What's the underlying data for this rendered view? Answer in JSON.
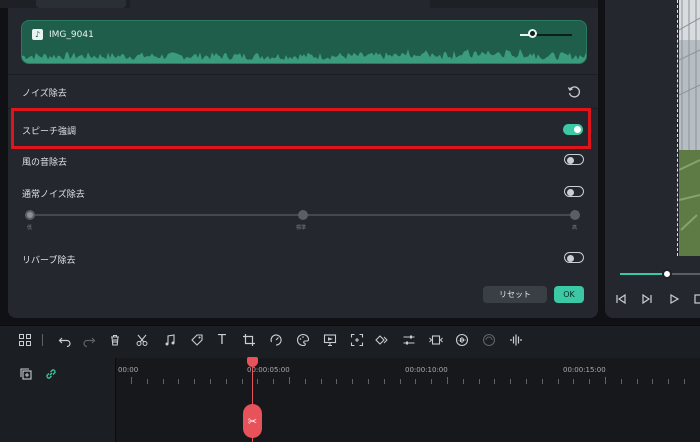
{
  "audio_clip": {
    "name": "IMG_9041"
  },
  "noise_section": {
    "title": "ノイズ除去"
  },
  "settings": [
    {
      "label": "スピーチ強調",
      "on": true
    },
    {
      "label": "風の音除去",
      "on": false
    },
    {
      "label": "通常ノイズ除去",
      "on": false
    },
    {
      "label": "リバーブ除去",
      "on": false
    }
  ],
  "noise_level": {
    "marks": [
      "低",
      "標準",
      "高"
    ],
    "value": 0.0
  },
  "buttons": {
    "reset": "リセット",
    "ok": "OK"
  },
  "player": {
    "progress": 0.6
  },
  "timeline": {
    "times": [
      "00:00",
      "00:00:05:00",
      "00:00:10:00",
      "00:00:15:00"
    ]
  },
  "colors": {
    "accent": "#3ac9a4",
    "highlight": "#e0141b",
    "playhead": "#e8525a"
  }
}
